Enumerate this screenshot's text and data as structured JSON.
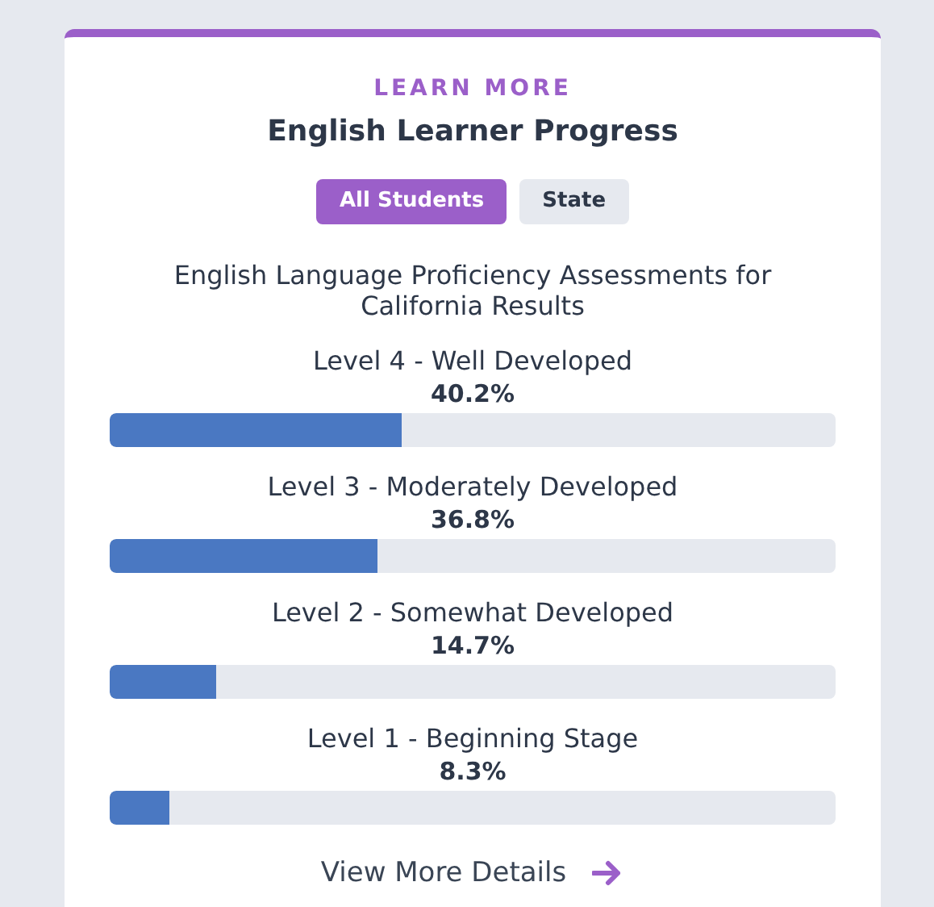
{
  "card": {
    "eyebrow": "LEARN MORE",
    "title": "English Learner Progress",
    "filters": [
      {
        "label": "All Students",
        "selected": true
      },
      {
        "label": "State",
        "selected": false
      }
    ],
    "subtitle": "English Language Proficiency Assessments for California Results",
    "levels": [
      {
        "label": "Level 4 - Well Developed",
        "value": "40.2%",
        "level": 0.402
      },
      {
        "label": "Level 3 - Moderately Developed",
        "value": "36.8%",
        "level": 0.368
      },
      {
        "label": "Level 2 - Somewhat Developed",
        "value": "14.7%",
        "level": 0.147
      },
      {
        "label": "Level 1 - Beginning Stage",
        "value": "8.3%",
        "level": 0.083
      }
    ],
    "link": "View More Details"
  }
}
